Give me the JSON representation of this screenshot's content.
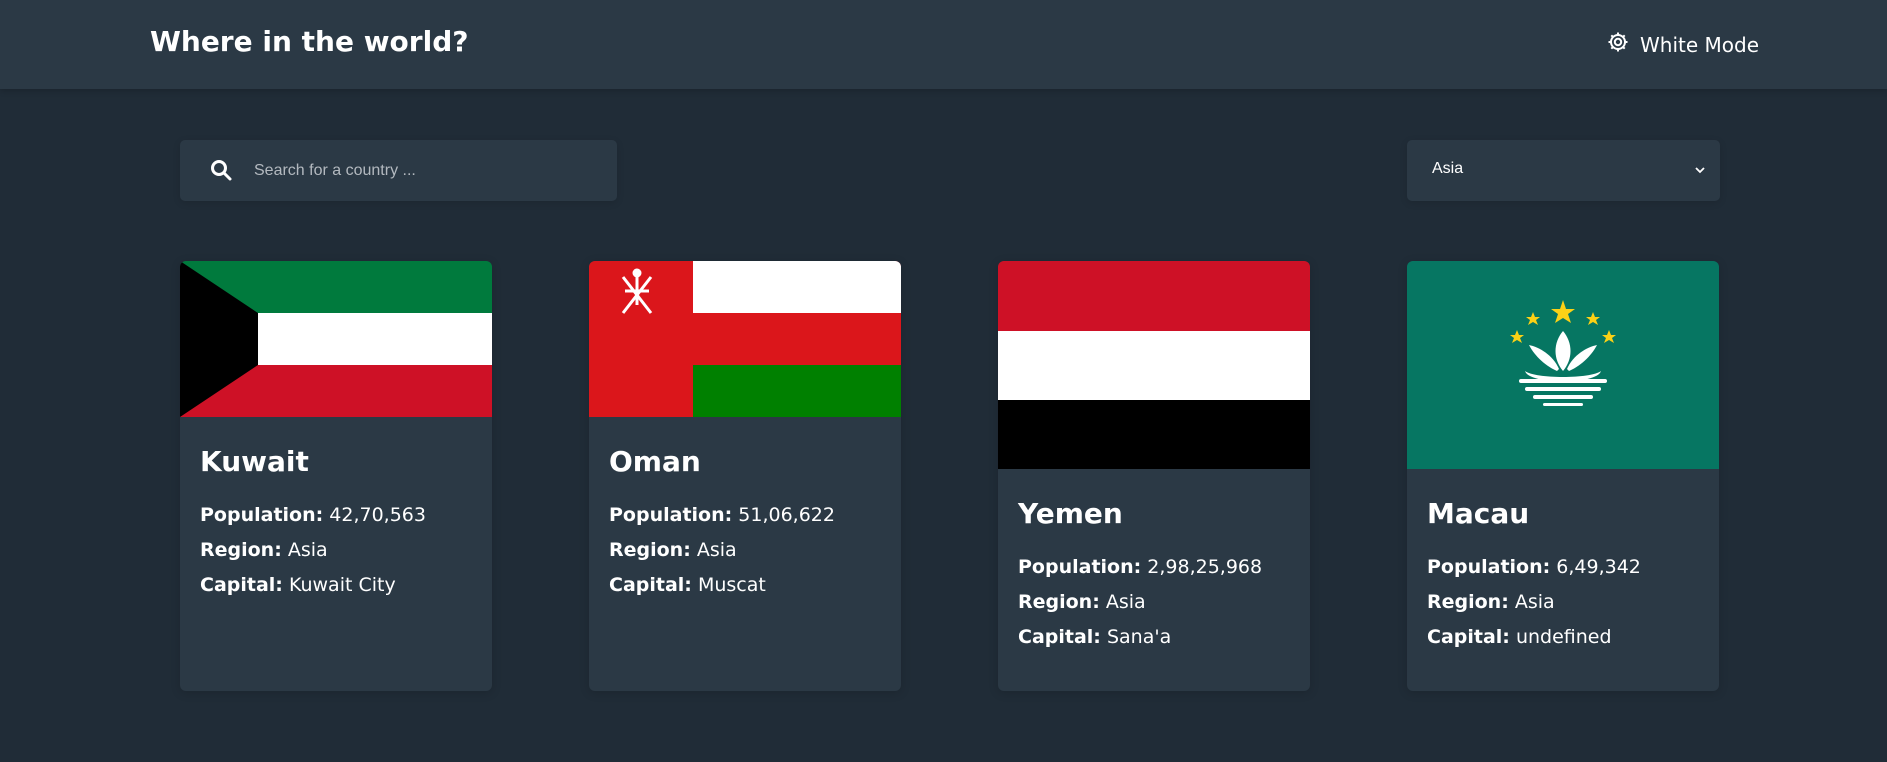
{
  "header": {
    "title": "Where in the world?",
    "mode_label": "White Mode",
    "mode_icon": "gear-icon"
  },
  "search": {
    "icon": "search-icon",
    "placeholder": "Search for a country ...",
    "value": ""
  },
  "filter": {
    "selected": "Asia",
    "icon": "chevron-down-icon"
  },
  "labels": {
    "population": "Population:",
    "region": "Region:",
    "capital": "Capital:"
  },
  "countries": [
    {
      "name": "Kuwait",
      "population": "42,70,563",
      "region": "Asia",
      "capital": "Kuwait City"
    },
    {
      "name": "Oman",
      "population": "51,06,622",
      "region": "Asia",
      "capital": "Muscat"
    },
    {
      "name": "Yemen",
      "population": "2,98,25,968",
      "region": "Asia",
      "capital": "Sana'a"
    },
    {
      "name": "Macau",
      "population": "6,49,342",
      "region": "Asia",
      "capital": "undefined"
    }
  ],
  "colors": {
    "background": "#202c37",
    "surface": "#2b3945",
    "text": "#ffffff"
  }
}
